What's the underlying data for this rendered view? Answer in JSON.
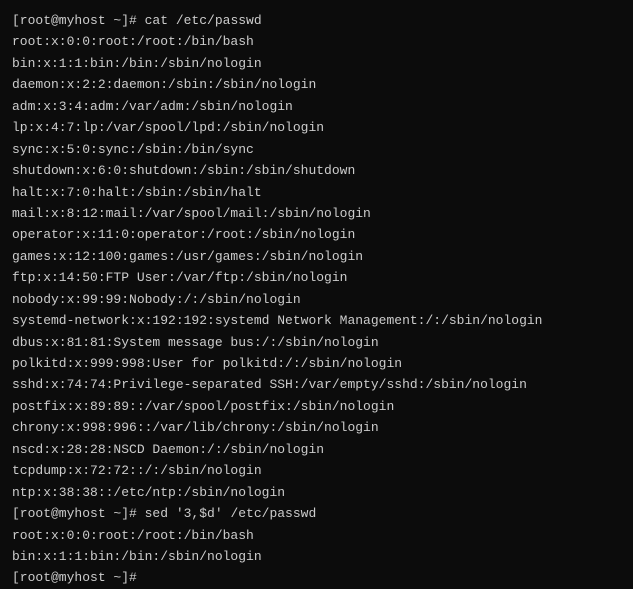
{
  "terminal": {
    "prompt1": "[root@myhost ~]# ",
    "command1": "cat /etc/passwd",
    "output1": [
      "root:x:0:0:root:/root:/bin/bash",
      "bin:x:1:1:bin:/bin:/sbin/nologin",
      "daemon:x:2:2:daemon:/sbin:/sbin/nologin",
      "adm:x:3:4:adm:/var/adm:/sbin/nologin",
      "lp:x:4:7:lp:/var/spool/lpd:/sbin/nologin",
      "sync:x:5:0:sync:/sbin:/bin/sync",
      "shutdown:x:6:0:shutdown:/sbin:/sbin/shutdown",
      "halt:x:7:0:halt:/sbin:/sbin/halt",
      "mail:x:8:12:mail:/var/spool/mail:/sbin/nologin",
      "operator:x:11:0:operator:/root:/sbin/nologin",
      "games:x:12:100:games:/usr/games:/sbin/nologin",
      "ftp:x:14:50:FTP User:/var/ftp:/sbin/nologin",
      "nobody:x:99:99:Nobody:/:/sbin/nologin",
      "systemd-network:x:192:192:systemd Network Management:/:/sbin/nologin",
      "dbus:x:81:81:System message bus:/:/sbin/nologin",
      "polkitd:x:999:998:User for polkitd:/:/sbin/nologin",
      "sshd:x:74:74:Privilege-separated SSH:/var/empty/sshd:/sbin/nologin",
      "postfix:x:89:89::/var/spool/postfix:/sbin/nologin",
      "chrony:x:998:996::/var/lib/chrony:/sbin/nologin",
      "nscd:x:28:28:NSCD Daemon:/:/sbin/nologin",
      "tcpdump:x:72:72::/:/sbin/nologin",
      "ntp:x:38:38::/etc/ntp:/sbin/nologin"
    ],
    "prompt2": "[root@myhost ~]# ",
    "command2": "sed '3,$d' /etc/passwd",
    "output2": [
      "root:x:0:0:root:/root:/bin/bash",
      "bin:x:1:1:bin:/bin:/sbin/nologin"
    ],
    "prompt3": "[root@myhost ~]#"
  }
}
